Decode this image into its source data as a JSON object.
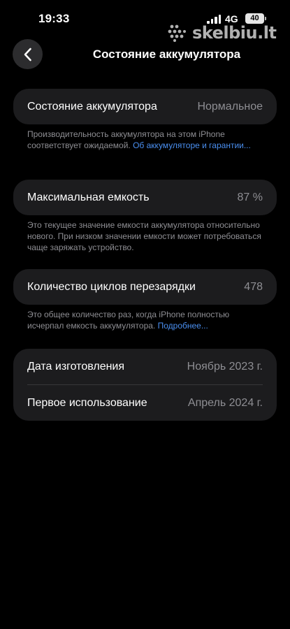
{
  "status_bar": {
    "time": "19:33",
    "network": "4G",
    "battery": "40"
  },
  "watermark": {
    "text": "skelbiu.lt"
  },
  "nav": {
    "back_icon": "chevron-left-icon",
    "title": "Состояние аккумулятора"
  },
  "health": {
    "label": "Состояние аккумулятора",
    "value": "Нормальное",
    "note": "Производительность аккумулятора на этом iPhone соответствует ожидаемой.",
    "link": "Об аккумуляторе и гарантии..."
  },
  "capacity": {
    "label": "Максимальная емкость",
    "value": "87 %",
    "note": "Это текущее значение емкости аккумулятора относительно нового. При низком значении емкости может потребоваться чаще заряжать устройство."
  },
  "cycles": {
    "label": "Количество циклов перезарядки",
    "value": "478",
    "note": "Это общее количество раз, когда iPhone полностью исчерпал емкость аккумулятора.",
    "link": "Подробнее..."
  },
  "dates": {
    "manufactured_label": "Дата изготовления",
    "manufactured_value": "Ноябрь 2023 г.",
    "first_use_label": "Первое использование",
    "first_use_value": "Апрель 2024 г."
  },
  "colors": {
    "background": "#000000",
    "cell": "#1c1c1e",
    "secondary_text": "#8e8e93",
    "link": "#4a8ff0"
  }
}
